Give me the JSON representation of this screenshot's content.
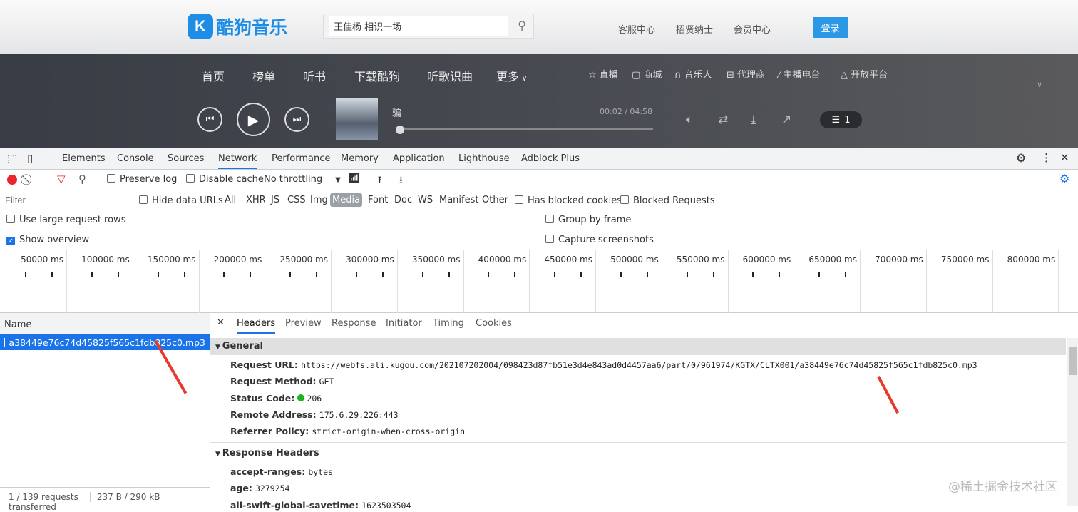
{
  "site": {
    "logo_letter": "K",
    "logo_text": "酷狗音乐",
    "search_value": "王佳杨 相识一场",
    "links": [
      "客服中心",
      "招贤纳士",
      "会员中心"
    ],
    "login": "登录",
    "nav": [
      "首页",
      "榜单",
      "听书",
      "下载酷狗",
      "听歌识曲",
      "更多"
    ],
    "subnav": [
      {
        "icon": "star-icon",
        "glyph": "☆",
        "label": "直播"
      },
      {
        "icon": "shop-icon",
        "glyph": "▢",
        "label": "商城"
      },
      {
        "icon": "headphone-icon",
        "glyph": "∩",
        "label": "音乐人"
      },
      {
        "icon": "agent-icon",
        "glyph": "⊟",
        "label": "代理商"
      },
      {
        "icon": "mic-icon",
        "glyph": "⁄",
        "label": "主播电台"
      },
      {
        "icon": "platform-icon",
        "glyph": "△",
        "label": "开放平台"
      }
    ],
    "player": {
      "song": "骗",
      "time": "00:02 / 04:58",
      "progress": 0.007,
      "playlist_count": "1"
    }
  },
  "devtools": {
    "tabs": [
      "Elements",
      "Console",
      "Sources",
      "Network",
      "Performance",
      "Memory",
      "Application",
      "Lighthouse",
      "Adblock Plus"
    ],
    "active_tab": "Network",
    "toolbar": {
      "preserve_log": "Preserve log",
      "disable_cache": "Disable cache",
      "throttling": "No throttling"
    },
    "filter": {
      "placeholder": "Filter",
      "hide_data_urls": "Hide data URLs",
      "types": [
        "All",
        "XHR",
        "JS",
        "CSS",
        "Img",
        "Media",
        "Font",
        "Doc",
        "WS",
        "Manifest",
        "Other"
      ],
      "active_type": "Media",
      "has_blocked_cookies": "Has blocked cookies",
      "blocked_requests": "Blocked Requests"
    },
    "options": {
      "large_rows": "Use large request rows",
      "show_overview": "Show overview",
      "group_by_frame": "Group by frame",
      "capture_screenshots": "Capture screenshots"
    },
    "overview_ticks": [
      "50000 ms",
      "100000 ms",
      "150000 ms",
      "200000 ms",
      "250000 ms",
      "300000 ms",
      "350000 ms",
      "400000 ms",
      "450000 ms",
      "500000 ms",
      "550000 ms",
      "600000 ms",
      "650000 ms",
      "700000 ms",
      "750000 ms",
      "800000 ms"
    ],
    "name_header": "Name",
    "request_name": "a38449e76c74d45825f565c1fdb825c0.mp3",
    "status_bar": {
      "requests": "1 / 139 requests",
      "transferred": "237 B / 290 kB transferred"
    },
    "detail_tabs": [
      "Headers",
      "Preview",
      "Response",
      "Initiator",
      "Timing",
      "Cookies"
    ],
    "general": {
      "title": "General",
      "rows": [
        {
          "k": "Request URL:",
          "v": "https://webfs.ali.kugou.com/202107202004/098423d87fb51e3d4e843ad0d4457aa6/part/0/961974/KGTX/CLTX001/a38449e76c74d45825f565c1fdb825c0.mp3"
        },
        {
          "k": "Request Method:",
          "v": "GET"
        },
        {
          "k": "Status Code:",
          "v": "206"
        },
        {
          "k": "Remote Address:",
          "v": "175.6.29.226:443"
        },
        {
          "k": "Referrer Policy:",
          "v": "strict-origin-when-cross-origin"
        }
      ]
    },
    "response_headers": {
      "title": "Response Headers",
      "rows": [
        {
          "k": "accept-ranges:",
          "v": "bytes"
        },
        {
          "k": "age:",
          "v": "3279254"
        },
        {
          "k": "ali-swift-global-savetime:",
          "v": "1623503504"
        }
      ]
    }
  },
  "watermark": "@稀土掘金技术社区",
  "colors": {
    "accent": "#1a73e8",
    "kugou": "#1d8de6",
    "arrow": "#e53a2e"
  }
}
